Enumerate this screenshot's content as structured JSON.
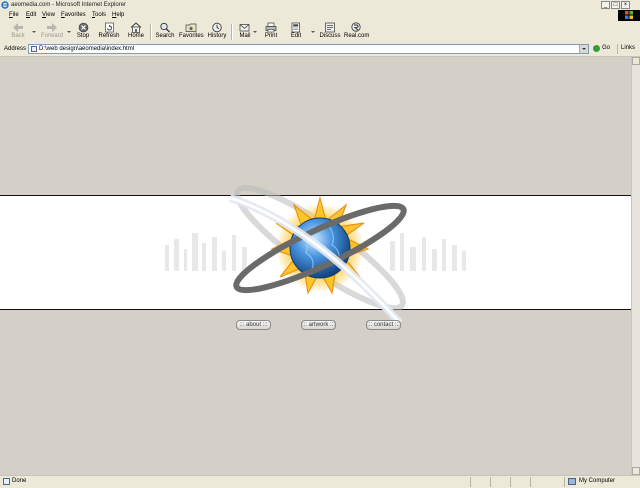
{
  "window": {
    "title": "aeomedia.com - Microsoft Internet Explorer"
  },
  "menu": [
    "File",
    "Edit",
    "View",
    "Favorites",
    "Tools",
    "Help"
  ],
  "toolbar": {
    "back": "Back",
    "forward": "Forward",
    "stop": "Stop",
    "refresh": "Refresh",
    "home": "Home",
    "search": "Search",
    "favorites": "Favorites",
    "history": "History",
    "mail": "Mail",
    "print": "Print",
    "edit": "Edit",
    "discuss": "Discuss",
    "realcom": "Real.com"
  },
  "address": {
    "label": "Address",
    "url": "D:\\web design\\aeomedia\\index.html",
    "go": "Go",
    "links": "Links"
  },
  "page": {
    "nav": [
      "about",
      "artwork",
      "contact"
    ]
  },
  "status": {
    "text": "Done",
    "zone": "My Computer"
  }
}
